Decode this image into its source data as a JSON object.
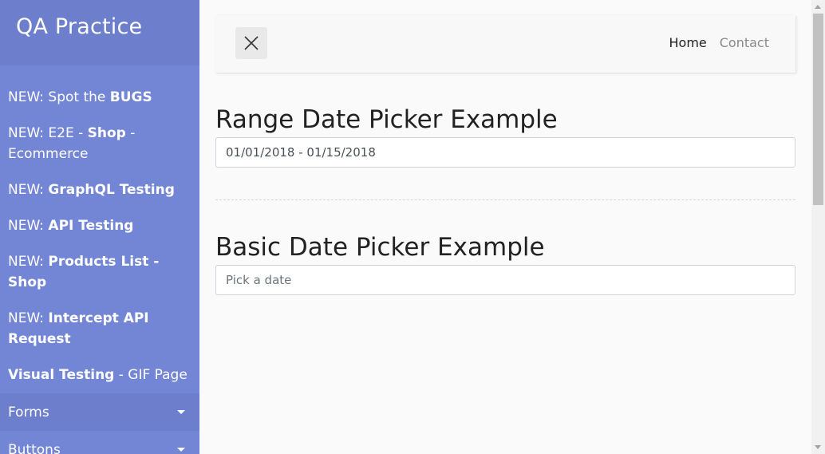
{
  "sidebar": {
    "brand": "QA Practice",
    "items": [
      {
        "prefix": "NEW: Spot the ",
        "bold": "BUGS",
        "suffix": ""
      },
      {
        "prefix": "NEW: E2E - ",
        "bold": "Shop",
        "suffix": " - Ecommerce"
      },
      {
        "prefix": "NEW: ",
        "bold": "GraphQL Testing",
        "suffix": ""
      },
      {
        "prefix": "NEW: ",
        "bold": "API Testing",
        "suffix": ""
      },
      {
        "prefix": "NEW: ",
        "bold": "Products List - Shop",
        "suffix": ""
      },
      {
        "prefix": "NEW: ",
        "bold": "Intercept API Request",
        "suffix": ""
      },
      {
        "prefix": "",
        "bold": "Visual Testing",
        "suffix": " - GIF Page"
      }
    ],
    "dropdowns": [
      {
        "label": "Forms"
      },
      {
        "label": "Buttons"
      }
    ]
  },
  "navbar": {
    "toggle_icon": "close-icon",
    "links": [
      {
        "label": "Home"
      },
      {
        "label": "Contact"
      }
    ]
  },
  "range_section": {
    "title": "Range Date Picker Example",
    "value": "01/01/2018 - 01/15/2018"
  },
  "basic_section": {
    "title": "Basic Date Picker Example",
    "placeholder": "Pick a date",
    "value": ""
  },
  "colors": {
    "sidebar": "#7386d5",
    "sidebar_header": "#6d7fcc"
  }
}
